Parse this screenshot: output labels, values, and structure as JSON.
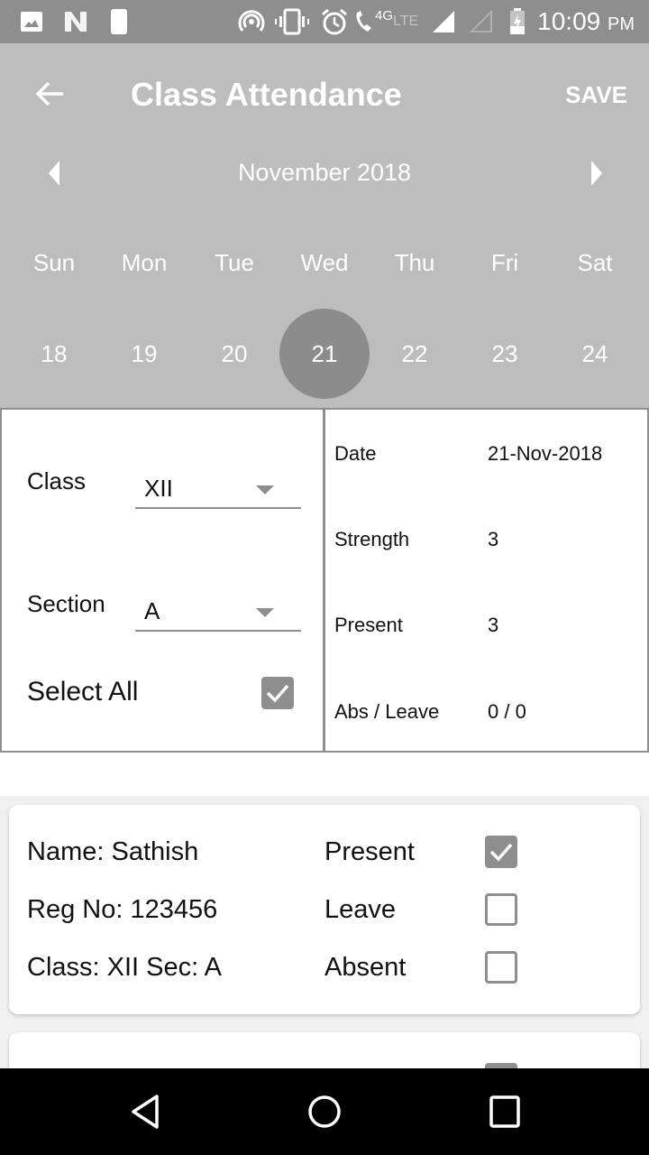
{
  "status_bar": {
    "left_icons": [
      "image-icon",
      "n-logo-icon",
      "moon-notification-icon"
    ],
    "right_icons": [
      "hotspot-icon",
      "vibrate-icon",
      "alarm-icon",
      "volte-call-icon",
      "lte-icon",
      "signal-full-icon",
      "signal-empty-icon",
      "battery-charging-icon"
    ],
    "volte_label": "4G",
    "lte_label": "LTE",
    "time": "10:09",
    "ampm": "PM"
  },
  "app_bar": {
    "title": "Class Attendance",
    "save_label": "SAVE"
  },
  "calendar": {
    "month_label": "November 2018",
    "weekdays": [
      "Sun",
      "Mon",
      "Tue",
      "Wed",
      "Thu",
      "Fri",
      "Sat"
    ],
    "days": [
      "18",
      "19",
      "20",
      "21",
      "22",
      "23",
      "24"
    ],
    "selected_day": "21"
  },
  "filters": {
    "class_label": "Class",
    "class_value": "XII",
    "section_label": "Section",
    "section_value": "A",
    "select_all_label": "Select All",
    "select_all_checked": true
  },
  "summary": [
    {
      "label": "Date",
      "value": "21-Nov-2018"
    },
    {
      "label": "Strength",
      "value": "3"
    },
    {
      "label": "Present",
      "value": "3"
    },
    {
      "label": "Abs / Leave",
      "value": "0 / 0"
    }
  ],
  "students": [
    {
      "name": "Name: Sathish",
      "reg": "Reg No: 123456",
      "class_sec": "Class: XII Sec: A",
      "options": [
        {
          "label": "Present",
          "checked": true
        },
        {
          "label": "Leave",
          "checked": false
        },
        {
          "label": "Absent",
          "checked": false
        }
      ]
    }
  ],
  "colors": {
    "app_bar": "#bdbdbd",
    "status_bar": "#8e8e8e",
    "accent": "#8e8e8e",
    "selected_day": "#8c8c8c"
  }
}
